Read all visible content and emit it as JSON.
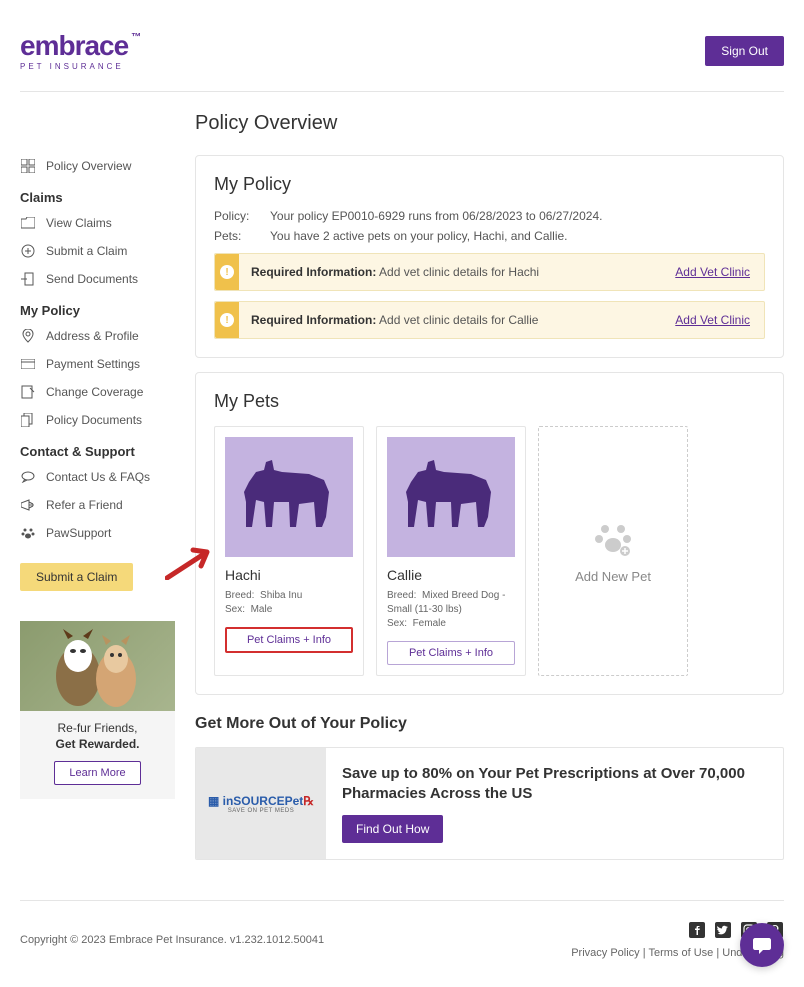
{
  "header": {
    "logo_main": "embrace",
    "logo_sub": "PET INSURANCE",
    "sign_out": "Sign Out"
  },
  "page_title": "Policy Overview",
  "sidebar": {
    "overview": "Policy Overview",
    "claims_head": "Claims",
    "view_claims": "View Claims",
    "submit_claim": "Submit a Claim",
    "send_docs": "Send Documents",
    "mypolicy_head": "My Policy",
    "address": "Address & Profile",
    "payment": "Payment Settings",
    "coverage": "Change Coverage",
    "policy_docs": "Policy Documents",
    "support_head": "Contact & Support",
    "contact": "Contact Us & FAQs",
    "refer": "Refer a Friend",
    "pawsupport": "PawSupport",
    "submit_btn": "Submit a Claim"
  },
  "promo_side": {
    "line1": "Re-fur Friends,",
    "line2": "Get Rewarded.",
    "btn": "Learn More"
  },
  "my_policy": {
    "title": "My Policy",
    "policy_label": "Policy:",
    "policy_text": "Your policy EP0010-6929 runs from 06/28/2023 to 06/27/2024.",
    "pets_label": "Pets:",
    "pets_text": "You have 2 active pets on your policy, Hachi, and Callie.",
    "alert_label": "Required Information:",
    "alert1_text": " Add vet clinic details for Hachi",
    "alert2_text": " Add vet clinic details for Callie",
    "alert_link": "Add Vet Clinic"
  },
  "my_pets": {
    "title": "My Pets",
    "pet1": {
      "name": "Hachi",
      "breed_label": "Breed:",
      "breed": "Shiba Inu",
      "sex_label": "Sex:",
      "sex": "Male",
      "btn": "Pet Claims + Info"
    },
    "pet2": {
      "name": "Callie",
      "breed_label": "Breed:",
      "breed": "Mixed Breed Dog - Small (11-30 lbs)",
      "sex_label": "Sex:",
      "sex": "Female",
      "btn": "Pet Claims + Info"
    },
    "add_new": "Add New Pet"
  },
  "get_more": {
    "title": "Get More Out of Your Policy",
    "promo_brand": "inSOURCEPet",
    "promo_sub": "SAVE ON PET MEDS",
    "promo_title": "Save up to 80% on Your Pet Prescriptions at Over 70,000 Pharmacies Across the US",
    "promo_btn": "Find Out How"
  },
  "footer": {
    "copyright": "Copyright © 2023   Embrace Pet Insurance. v1.232.1012.50041",
    "privacy": "Privacy Policy",
    "terms": "Terms of Use",
    "underwriting": "Underwriting",
    "sep": " | "
  }
}
